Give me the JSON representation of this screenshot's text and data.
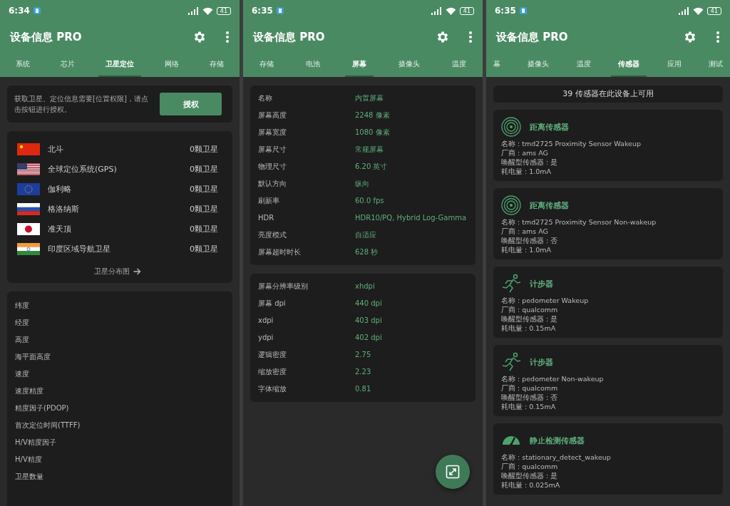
{
  "panels": [
    {
      "kind": "gnss",
      "status_time": "6:34",
      "battery": "41",
      "title": "设备信息 PRO",
      "tabs": [
        {
          "label": "系统",
          "selected": false
        },
        {
          "label": "芯片",
          "selected": false
        },
        {
          "label": "卫星定位",
          "selected": true
        },
        {
          "label": "网络",
          "selected": false
        },
        {
          "label": "存储",
          "selected": false
        }
      ],
      "permission": {
        "text": "获取卫星、定位信息需要[位置权限]，请点击按钮进行授权。",
        "button": "授权"
      },
      "constellations": [
        {
          "kind": "cn",
          "name": "北斗",
          "count": "0颗卫星"
        },
        {
          "kind": "us",
          "name": "全球定位系统(GPS)",
          "count": "0颗卫星"
        },
        {
          "kind": "eu",
          "name": "伽利略",
          "count": "0颗卫星"
        },
        {
          "kind": "ru",
          "name": "格洛纳斯",
          "count": "0颗卫星"
        },
        {
          "kind": "jp",
          "name": "准天顶",
          "count": "0颗卫星"
        },
        {
          "kind": "in",
          "name": "印度区域导航卫星",
          "count": "0颗卫星"
        }
      ],
      "map_link": "卫星分布图",
      "fields": [
        "纬度",
        "经度",
        "高度",
        "海平面高度",
        "速度",
        "速度精度",
        "精度因子(PDOP)",
        "首次定位时间(TTFF)",
        "H/V精度因子",
        "H/V精度",
        "卫星数量"
      ]
    },
    {
      "kind": "display",
      "status_time": "6:35",
      "battery": "41",
      "title": "设备信息 PRO",
      "tabs": [
        {
          "label": "存储",
          "selected": false
        },
        {
          "label": "电池",
          "selected": false
        },
        {
          "label": "屏幕",
          "selected": true
        },
        {
          "label": "摄像头",
          "selected": false
        },
        {
          "label": "温度",
          "selected": false
        }
      ],
      "groups": [
        [
          {
            "label": "名称",
            "value": "内置屏幕"
          },
          {
            "label": "屏幕高度",
            "value": "2248 像素"
          },
          {
            "label": "屏幕宽度",
            "value": "1080 像素"
          },
          {
            "label": "屏幕尺寸",
            "value": "常规屏幕"
          },
          {
            "label": "物理尺寸",
            "value": "6.20  英寸"
          },
          {
            "label": "默认方向",
            "value": "纵向"
          },
          {
            "label": "刷新率",
            "value": "60.0 fps"
          },
          {
            "label": "HDR",
            "value": "HDR10/PQ, Hybrid Log-Gamma"
          },
          {
            "label": "亮度模式",
            "value": "自适应"
          },
          {
            "label": "屏幕超时时长",
            "value": "628 秒"
          }
        ],
        [
          {
            "label": "屏幕分辨率级别",
            "value": "xhdpi"
          },
          {
            "label": "屏幕 dpi",
            "value": "440 dpi"
          },
          {
            "label": "xdpi",
            "value": "403 dpi"
          },
          {
            "label": "ydpi",
            "value": "402 dpi"
          },
          {
            "label": "逻辑密度",
            "value": "2.75"
          },
          {
            "label": "缩放密度",
            "value": "2.23"
          },
          {
            "label": "字体缩放",
            "value": "0.81"
          }
        ]
      ]
    },
    {
      "kind": "sensors",
      "status_time": "6:35",
      "battery": "41",
      "title": "设备信息 PRO",
      "tabs": [
        {
          "label": "幕",
          "selected": false
        },
        {
          "label": "摄像头",
          "selected": false
        },
        {
          "label": "温度",
          "selected": false
        },
        {
          "label": "传感器",
          "selected": true
        },
        {
          "label": "应用",
          "selected": false
        },
        {
          "label": "测试",
          "selected": false
        }
      ],
      "summary": "39 传感器在此设备上可用",
      "sensors": [
        {
          "kind": "proximity",
          "title": "距离传感器",
          "lines": [
            "名称 : tmd2725 Proximity Sensor Wakeup",
            "厂商 : ams AG",
            "唤醒型传感器 : 是",
            "耗电量 : 1.0mA"
          ]
        },
        {
          "kind": "proximity",
          "title": "距离传感器",
          "lines": [
            "名称 : tmd2725 Proximity Sensor Non-wakeup",
            "厂商 : ams AG",
            "唤醒型传感器 : 否",
            "耗电量 : 1.0mA"
          ]
        },
        {
          "kind": "step",
          "title": "计步器",
          "lines": [
            "名称 : pedometer  Wakeup",
            "厂商 : qualcomm",
            "唤醒型传感器 : 是",
            "耗电量 : 0.15mA"
          ]
        },
        {
          "kind": "step",
          "title": "计步器",
          "lines": [
            "名称 : pedometer  Non-wakeup",
            "厂商 : qualcomm",
            "唤醒型传感器 : 否",
            "耗电量 : 0.15mA"
          ]
        },
        {
          "kind": "stationary",
          "title": "静止检测传感器",
          "lines": [
            "名称 : stationary_detect_wakeup",
            "厂商 : qualcomm",
            "唤醒型传感器 : 是",
            "耗电量 : 0.025mA"
          ]
        }
      ]
    }
  ]
}
